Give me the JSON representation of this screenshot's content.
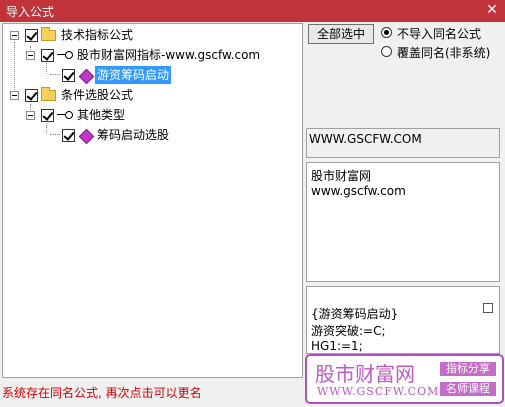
{
  "window": {
    "title": "导入公式",
    "close_label": "✕",
    "title_bar_color": "#c1333b"
  },
  "tree": [
    {
      "label": "技术指标公式",
      "checked": true,
      "icon": "folder-icon"
    },
    {
      "label": "股市财富网指标-www.gscfw.com",
      "checked": true,
      "icon": "key-icon"
    },
    {
      "label": "游资筹码启动",
      "checked": true,
      "icon": "diamond-icon",
      "selected": true
    },
    {
      "label": "条件选股公式",
      "checked": true,
      "icon": "folder-icon"
    },
    {
      "label": "其他类型",
      "checked": true,
      "icon": "key-icon"
    },
    {
      "label": "筹码启动选股",
      "checked": true,
      "icon": "diamond-icon"
    }
  ],
  "controls": {
    "select_all_label": "全部选中",
    "option_skip": "不导入同名公式",
    "option_overwrite": "覆盖同名(非系统)",
    "selected_option": "不导入同名公式"
  },
  "info": {
    "url_text": "WWW.GSCFW.COM",
    "desc_line1": "股市财富网",
    "desc_line2": "www.gscfw.com",
    "code_line1": "{游资筹码启动}",
    "code_line2": "游资突破:=C;",
    "code_line3": "HG1:=1;"
  },
  "status": {
    "text": "系统存在同名公式, 再次点击可以更名",
    "color": "#d40000"
  },
  "promo": {
    "title": "股市财富网",
    "url": "WWW.GSCFW.COM",
    "badge1": "指标分享",
    "badge2": "名师课程",
    "color": "#c058c8"
  }
}
